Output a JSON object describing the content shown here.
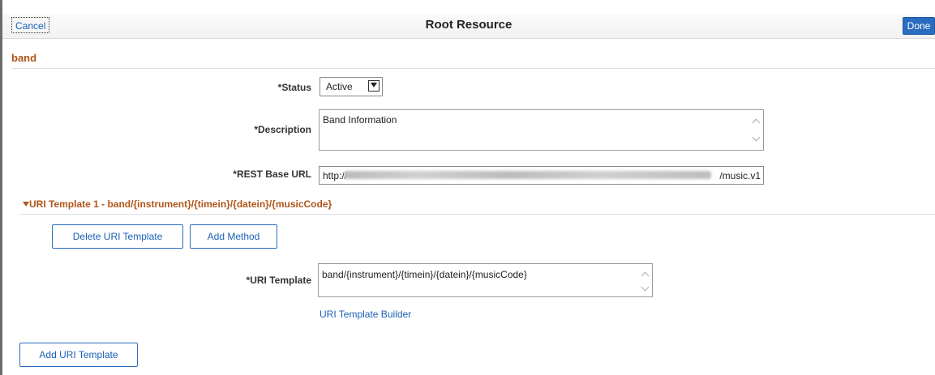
{
  "header": {
    "cancel_label": "Cancel",
    "title": "Root Resource",
    "done_label": "Done"
  },
  "resource": {
    "name": "band"
  },
  "form": {
    "status_label": "*Status",
    "status_value": "Active",
    "description_label": "*Description",
    "description_value": "Band Information",
    "rest_base_url_label": "*REST Base URL",
    "rest_base_url_prefix": "http://",
    "rest_base_url_suffix": "/music.v1"
  },
  "uri_template_section": {
    "title": "URI Template 1 - band/{instrument}/{timein}/{datein}/{musicCode}",
    "delete_label": "Delete URI Template",
    "add_method_label": "Add Method",
    "uri_template_label": "*URI Template",
    "uri_template_value": "band/{instrument}/{timein}/{datein}/{musicCode}",
    "builder_link": "URI Template Builder"
  },
  "footer": {
    "add_uri_template_label": "Add URI Template"
  },
  "colors": {
    "accent_blue": "#1a5fb4",
    "section_orange": "#b05418",
    "done_bg": "#2a6cbf"
  }
}
